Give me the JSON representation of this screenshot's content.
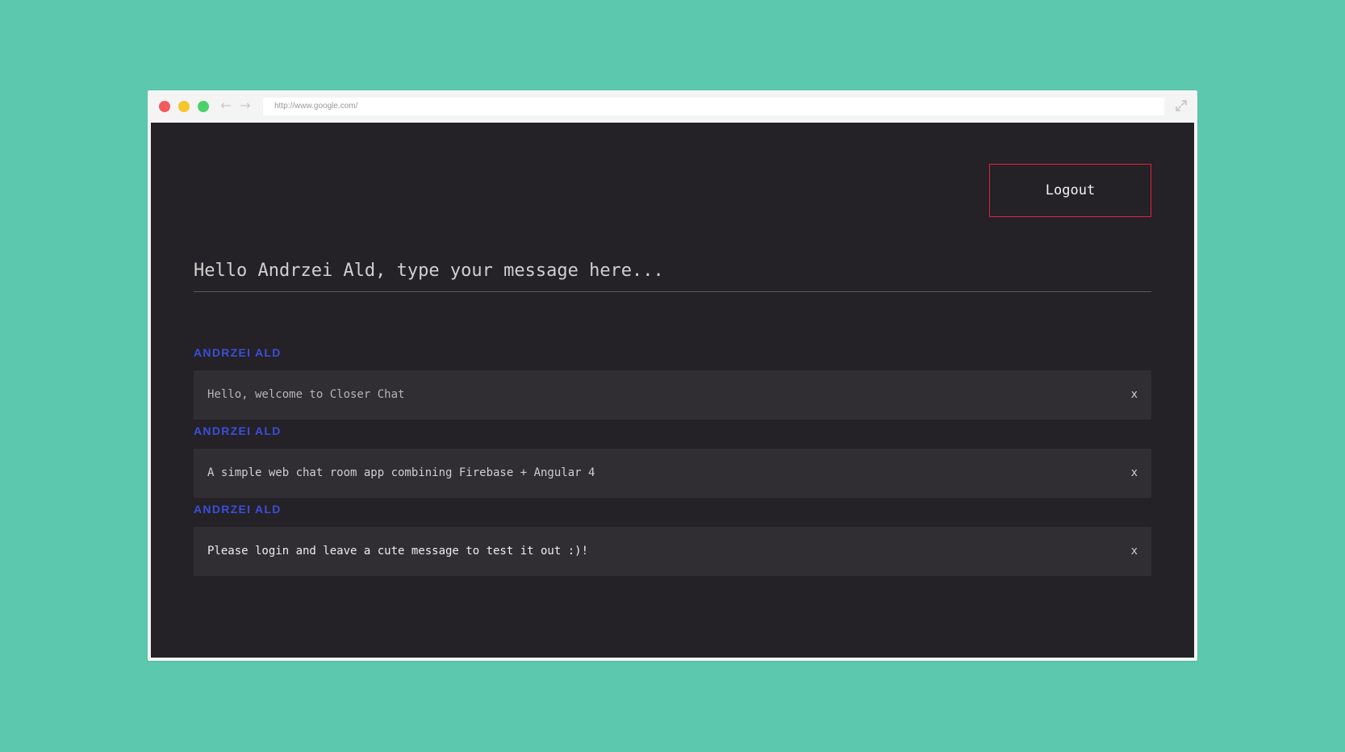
{
  "browser": {
    "url": "http://www.google.com/",
    "back_glyph": "←",
    "forward_glyph": "→",
    "icons": [
      "close-dot-icon",
      "minimize-dot-icon",
      "maximize-dot-icon",
      "back-arrow-icon",
      "forward-arrow-icon",
      "expand-icon"
    ]
  },
  "app": {
    "logout_label": "Logout",
    "input_placeholder": "Hello Andrzei Ald, type your message here...",
    "close_label": "x",
    "messages": [
      {
        "author": "ANDRZEI ALD",
        "text": "Hello, welcome to Closer Chat"
      },
      {
        "author": "ANDRZEI ALD",
        "text": "A simple web chat room app combining Firebase + Angular 4"
      },
      {
        "author": "ANDRZEI ALD",
        "text": "Please login and leave a cute message to test it out :)!"
      }
    ]
  },
  "colors": {
    "background": "#5cc8ae",
    "app_background": "#242127",
    "message_background": "#302d33",
    "author_color": "#3b4fd8",
    "logout_border": "#e0243b"
  }
}
